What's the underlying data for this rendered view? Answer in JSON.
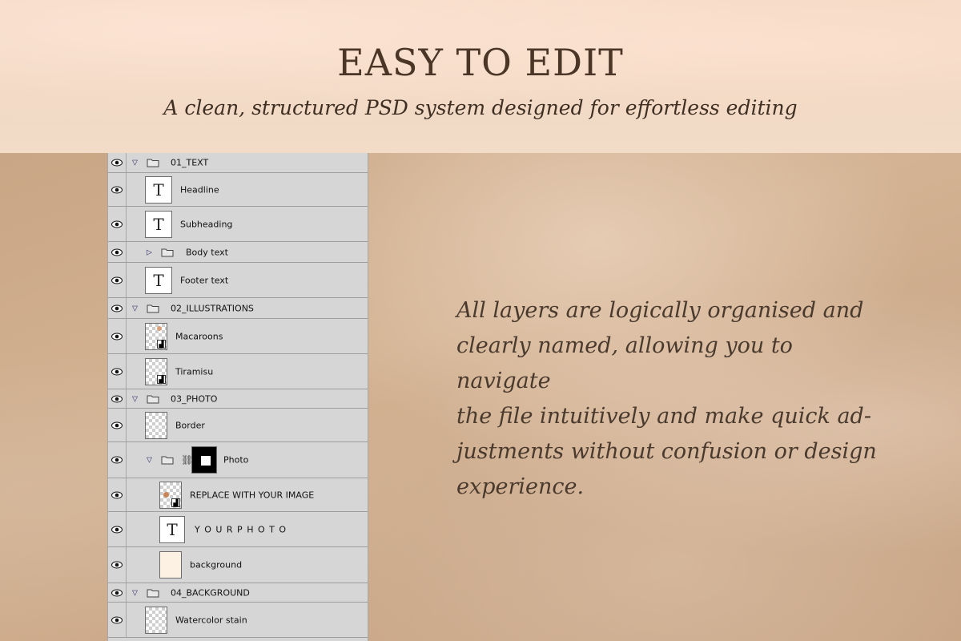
{
  "header": {
    "title": "EASY TO EDIT",
    "subtitle": "A clean, structured PSD system designed for effortless editing"
  },
  "description": {
    "line1": "All layers are logically organised and",
    "line2": "clearly named, allowing you to navigate",
    "line3": "the file intuitively and make quick ad-",
    "line4": "justments without confusion or design",
    "line5": "experience."
  },
  "layers": {
    "group1": "01_TEXT",
    "headline": "Headline",
    "subheading": "Subheading",
    "body_text": "Body text",
    "footer_text": "Footer text",
    "group2": "02_ILLUSTRATIONS",
    "macaroons": "Macaroons",
    "tiramisu": "Tiramisu",
    "group3": "03_PHOTO",
    "border": "Border",
    "photo": "Photo",
    "replace_image": "REPLACE WITH YOUR IMAGE",
    "your_photo": "Y O U R P H O T O",
    "background": "background",
    "group4": "04_BACKGROUND",
    "watercolor": "Watercolor stain",
    "text_thumb_glyph": "T"
  },
  "colors": {
    "title": "#4a3526",
    "panel": "#d6d6d6",
    "background_fill": "#fdf1e3"
  }
}
